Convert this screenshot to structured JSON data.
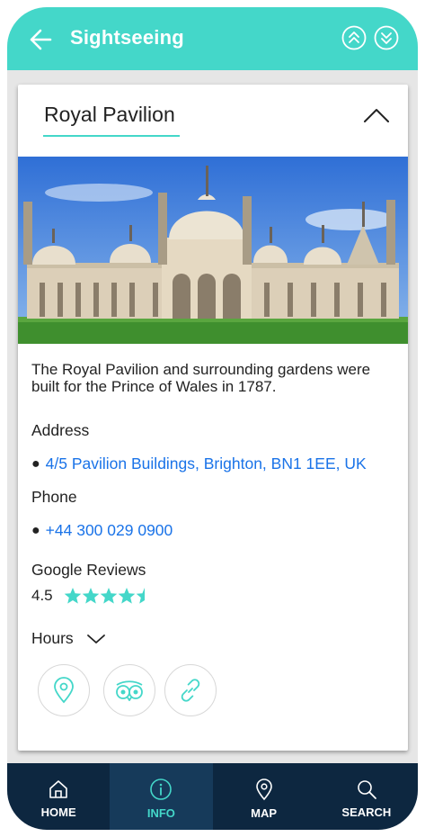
{
  "header": {
    "title": "Sightseeing",
    "back_icon": "arrow-left-icon",
    "up_icon": "double-chevron-up-icon",
    "down_icon": "double-chevron-down-icon"
  },
  "card": {
    "title": "Royal Pavilion",
    "collapse_icon": "chevron-up-icon",
    "image_icon": "royal-pavilion-photo",
    "description": "The Royal Pavilion and surrounding gardens were built for the Prince of Wales in 1787.",
    "address_label": "Address",
    "address": "4/5 Pavilion Buildings, Brighton, BN1 1EE, UK",
    "phone_label": "Phone",
    "phone": "+44 300 029 0900",
    "reviews_label": "Google Reviews",
    "rating": "4.5",
    "rating_value": 4.5,
    "rating_max": 5,
    "hours_label": "Hours",
    "actions": [
      {
        "icon": "map-pin-icon"
      },
      {
        "icon": "tripadvisor-icon"
      },
      {
        "icon": "link-icon"
      }
    ]
  },
  "nav": {
    "items": [
      {
        "label": "HOME",
        "icon": "home-icon",
        "active": false
      },
      {
        "label": "INFO",
        "icon": "info-icon",
        "active": true
      },
      {
        "label": "MAP",
        "icon": "map-pin-icon",
        "active": false
      },
      {
        "label": "SEARCH",
        "icon": "search-icon",
        "active": false
      }
    ]
  },
  "colors": {
    "accent": "#44d7c9",
    "nav_bg": "#0d2740",
    "link": "#1a73e8"
  }
}
